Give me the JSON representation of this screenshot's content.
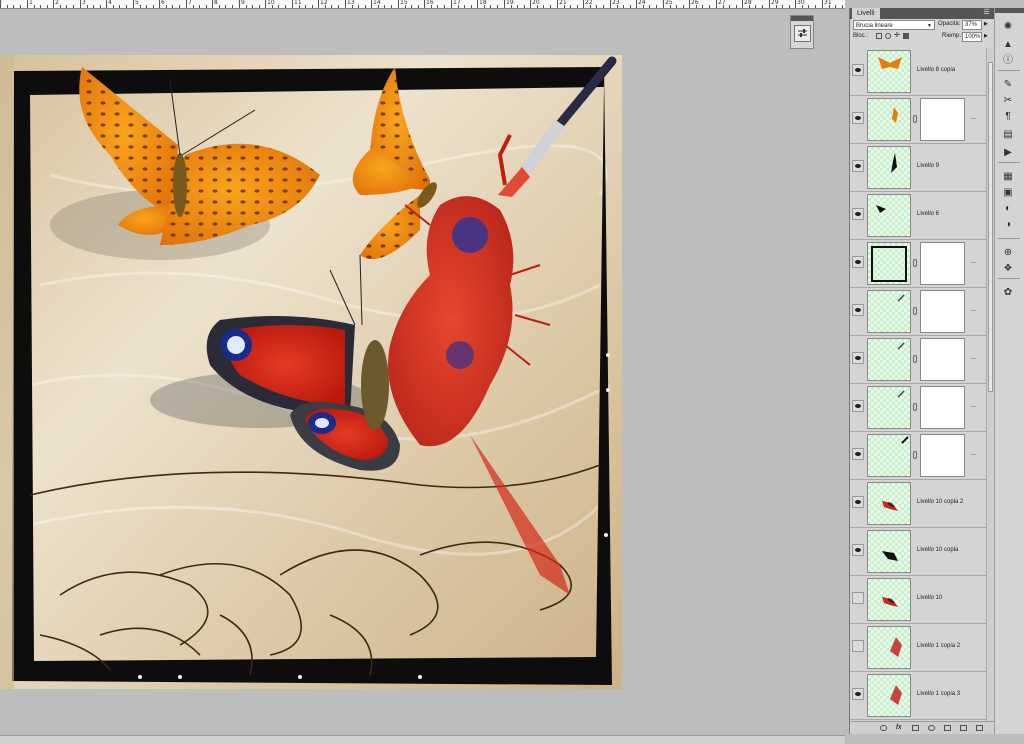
{
  "ruler": {
    "numbers": [
      "",
      "1",
      "2",
      "3",
      "4",
      "5",
      "6",
      "7",
      "8",
      "9",
      "10",
      "11",
      "12",
      "13",
      "14",
      "15",
      "16",
      "17",
      "18",
      "19",
      "20",
      "21",
      "22",
      "23",
      "24",
      "25",
      "26",
      "27",
      "28",
      "29",
      "30",
      "31"
    ]
  },
  "layers_panel": {
    "tab_label": "Livelli",
    "menu_icon": "panel-menu-icon",
    "blend_mode": "Brucia lineare",
    "opacity_label": "Opacità:",
    "opacity_value": "37%",
    "lock_label": "Bloc.:",
    "fill_label": "Riemp.:",
    "fill_value": "100%",
    "layers": [
      {
        "name": "Livello 8 copia",
        "visible": true,
        "mask": false,
        "thumb": "orange-butterfly"
      },
      {
        "name": "...",
        "visible": true,
        "mask": true,
        "thumb": "orange-butterfly-small"
      },
      {
        "name": "Livello 9",
        "visible": true,
        "mask": false,
        "thumb": "black-shape"
      },
      {
        "name": "Livello 6",
        "visible": true,
        "mask": false,
        "thumb": "black-shape-small"
      },
      {
        "name": "...",
        "visible": true,
        "mask": true,
        "thumb": "frame"
      },
      {
        "name": "...",
        "visible": true,
        "mask": true,
        "thumb": "brush-stroke"
      },
      {
        "name": "...",
        "visible": true,
        "mask": true,
        "thumb": "brush-stroke"
      },
      {
        "name": "...",
        "visible": true,
        "mask": true,
        "thumb": "brush-stroke"
      },
      {
        "name": "...",
        "visible": true,
        "mask": true,
        "thumb": "brush-line"
      },
      {
        "name": "Livello 10 copia 2",
        "visible": true,
        "mask": false,
        "thumb": "red-butterfly"
      },
      {
        "name": "Livello 10 copia",
        "visible": true,
        "mask": false,
        "thumb": "black-butterfly"
      },
      {
        "name": "Livello 10",
        "visible": false,
        "mask": false,
        "thumb": "red-butterfly"
      },
      {
        "name": "Livello 1 copia 2",
        "visible": false,
        "mask": false,
        "thumb": "red-wing"
      },
      {
        "name": "Livello 1 copia 3",
        "visible": true,
        "mask": false,
        "thumb": "red-wing"
      }
    ]
  },
  "colors": {
    "canvas_bg": "#bdbdbd",
    "panel_bg": "#d4d4d4",
    "panel_header": "#555555",
    "paper": "#e6d6bb",
    "frame": "#0d0d0d",
    "orange": "#f08a10",
    "red": "#d42a1a"
  },
  "toolbar_icons": [
    "history-icon",
    "actions-icon",
    "info-icon",
    "brush-icon",
    "clone-source-icon",
    "character-icon",
    "paragraph-icon",
    "animation-icon",
    "layers-icon",
    "channels-icon",
    "adjustments-icon",
    "masks-icon",
    "3d-icon",
    "swatches-icon",
    "styles-icon"
  ]
}
